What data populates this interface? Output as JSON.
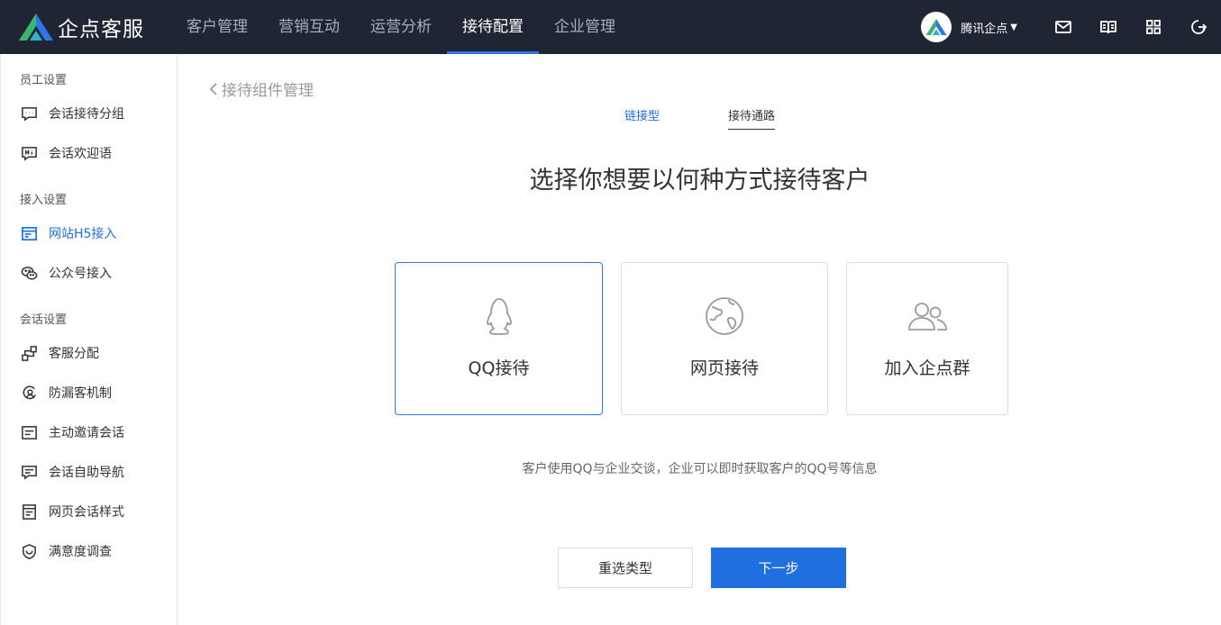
{
  "brand": {
    "name": "企点客服"
  },
  "nav": [
    {
      "label": "客户管理"
    },
    {
      "label": "营销互动"
    },
    {
      "label": "运营分析"
    },
    {
      "label": "接待配置"
    },
    {
      "label": "企业管理"
    }
  ],
  "nav_active": "接待配置",
  "user": {
    "name": "腾讯企点"
  },
  "tools": [
    "mail-icon",
    "book-icon",
    "apps-grid-icon",
    "logout-icon"
  ],
  "sidebar": {
    "sections": [
      {
        "title": "员工设置"
      },
      {
        "title": "接入设置"
      },
      {
        "title": "会话设置"
      }
    ],
    "items": [
      {
        "label": "会话接待分组",
        "icon": "chat-group-icon"
      },
      {
        "label": "会话欢迎语",
        "icon": "welcome-hi-icon"
      },
      {
        "label": "网站H5接入",
        "icon": "website-icon"
      },
      {
        "label": "公众号接入",
        "icon": "wechat-icon"
      },
      {
        "label": "客服分配",
        "icon": "distribution-icon"
      },
      {
        "label": "防漏客机制",
        "icon": "anti-loss-icon"
      },
      {
        "label": "主动邀请会话",
        "icon": "invite-icon"
      },
      {
        "label": "会话自助导航",
        "icon": "navigation-icon"
      },
      {
        "label": "网页会话样式",
        "icon": "style-icon"
      },
      {
        "label": "满意度调查",
        "icon": "survey-icon"
      }
    ],
    "active": "网站H5接入"
  },
  "main": {
    "back_label": "接待组件管理",
    "tabs": [
      {
        "label": "链接型"
      },
      {
        "label": "接待通路"
      }
    ],
    "headline": "选择你想要以何种方式接待客户",
    "cards": [
      {
        "label": "QQ接待",
        "icon": "qq-penguin-icon",
        "selected": true
      },
      {
        "label": "网页接待",
        "icon": "globe-icon",
        "selected": false
      },
      {
        "label": "加入企点群",
        "icon": "group-users-icon",
        "selected": false
      }
    ],
    "description": "客户使用QQ与企业交谈，企业可以即时获取客户的QQ号等信息",
    "buttons": {
      "reselect": "重选类型",
      "next": "下一步"
    }
  },
  "colors": {
    "topbar_bg": "#1f2533",
    "accent": "#1f6fe0",
    "card_selected_border": "#2f74e8"
  }
}
